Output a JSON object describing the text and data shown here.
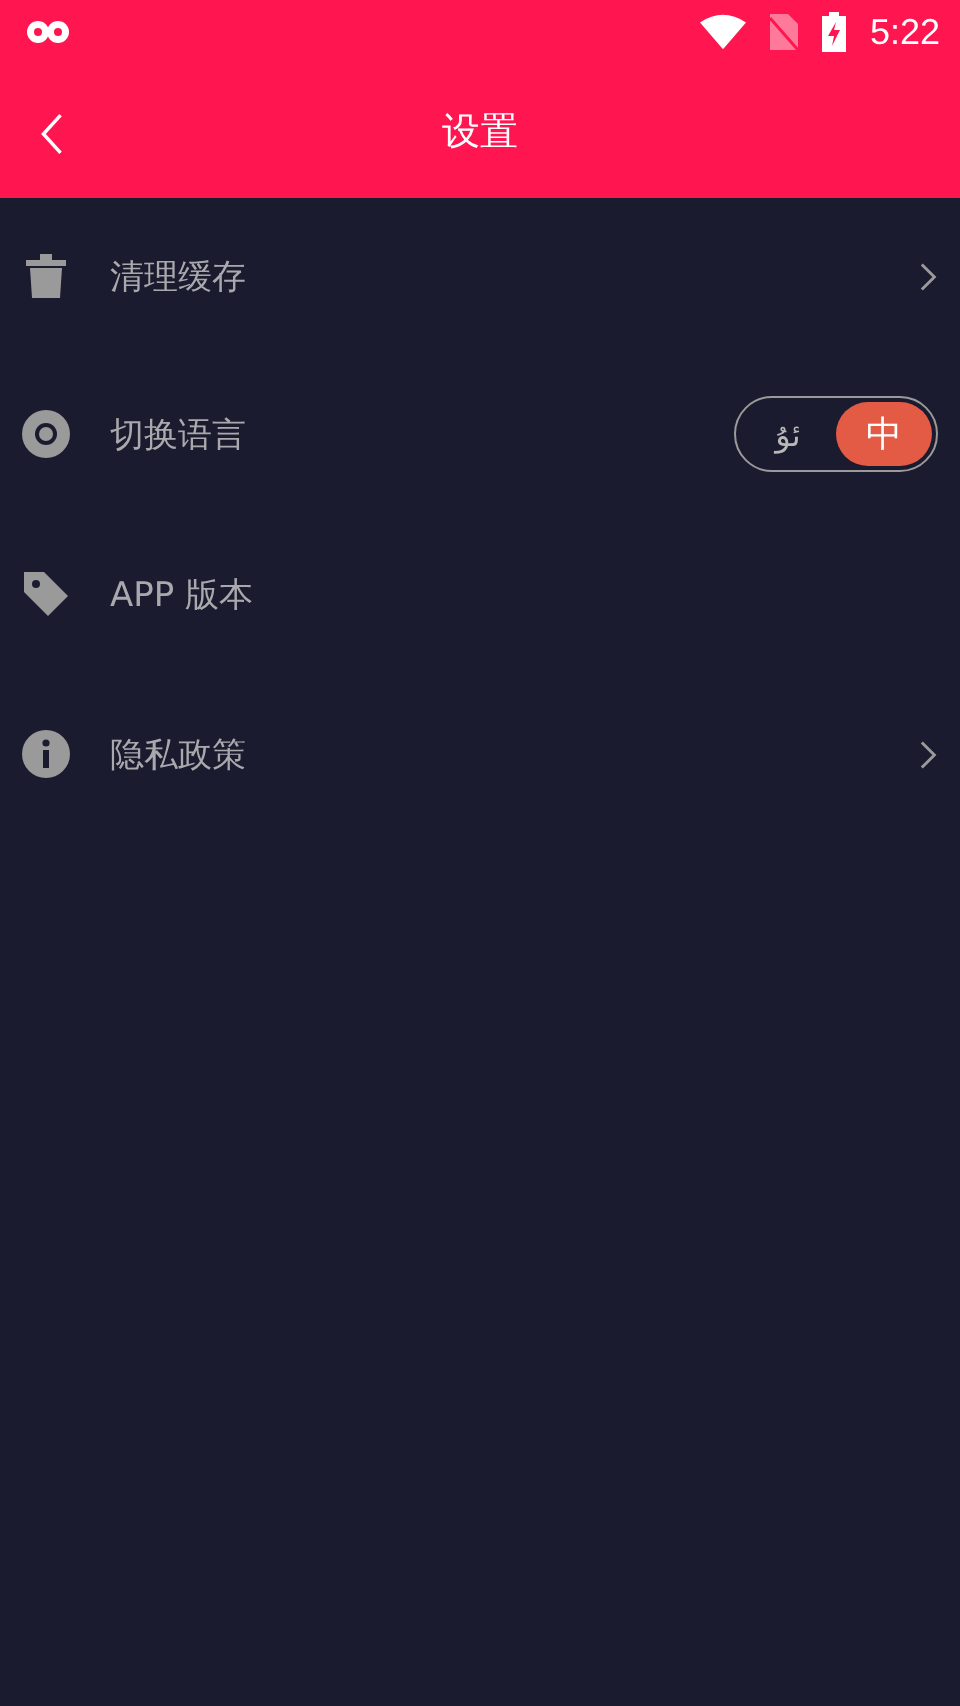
{
  "status_bar": {
    "time": "5:22"
  },
  "header": {
    "title": "设置"
  },
  "items": [
    {
      "kind": "link",
      "label": "清理缓存"
    },
    {
      "kind": "toggle",
      "label": "切换语言",
      "options": [
        {
          "label": "ئۇ",
          "selected": false
        },
        {
          "label": "中",
          "selected": true
        }
      ]
    },
    {
      "kind": "plain",
      "label": "APP 版本"
    },
    {
      "kind": "link",
      "label": "隐私政策"
    }
  ]
}
